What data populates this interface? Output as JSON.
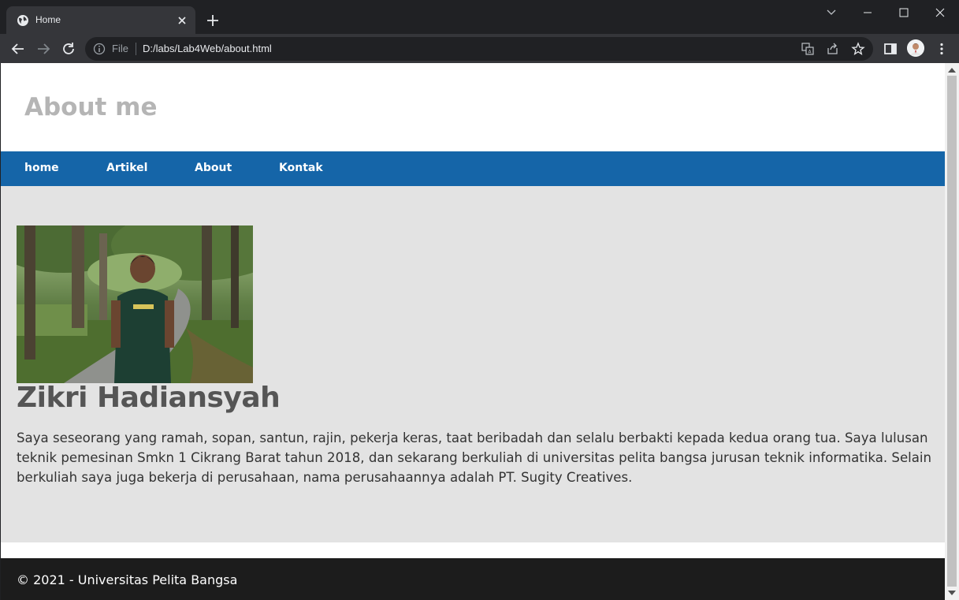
{
  "browser": {
    "tab_title": "Home",
    "omnibox": {
      "scheme_label": "File",
      "url": "D:/labs/Lab4Web/about.html"
    }
  },
  "site": {
    "title": "About me",
    "nav": [
      {
        "label": "home"
      },
      {
        "label": "Artikel"
      },
      {
        "label": "About"
      },
      {
        "label": "Kontak"
      }
    ]
  },
  "profile": {
    "name": "Zikri Hadiansyah",
    "bio": "Saya seseorang yang ramah, sopan, santun, rajin, pekerja keras, taat beribadah dan selalu berbakti kepada kedua orang tua. Saya lulusan teknik pemesinan Smkn 1 Cikrang Barat tahun 2018, dan sekarang berkuliah di universitas pelita bangsa jurusan teknik informatika. Selain berkuliah saya juga bekerja di perusahaan, nama perusahaannya adalah PT. Sugity Creatives."
  },
  "footer": {
    "text": "© 2021 - Universitas Pelita Bangsa"
  },
  "colors": {
    "nav_background": "#1565a8",
    "content_background": "#e3e3e3",
    "footer_background": "#1c1c1c",
    "title_color": "#b5b5b5"
  },
  "icons": [
    "globe-icon",
    "close-icon",
    "plus-icon",
    "chevron-down-icon",
    "minimize-icon",
    "maximize-icon",
    "back-icon",
    "forward-icon",
    "reload-icon",
    "info-icon",
    "translate-icon",
    "share-icon",
    "star-icon",
    "side-panel-icon",
    "menu-icon"
  ]
}
